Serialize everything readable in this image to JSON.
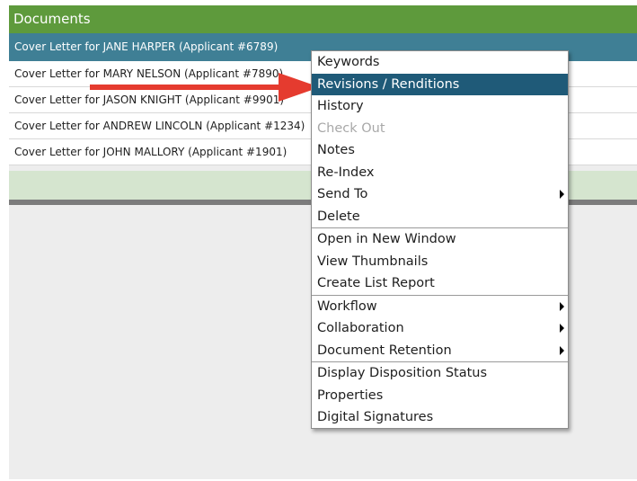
{
  "panel": {
    "title": "Documents",
    "rows": [
      "Cover Letter for JANE HARPER (Applicant #6789)",
      "Cover Letter for MARY NELSON (Applicant #7890)",
      "Cover Letter for JASON KNIGHT (Applicant #9901)",
      "Cover Letter for ANDREW LINCOLN (Applicant #1234)",
      "Cover Letter for JOHN MALLORY (Applicant #1901)"
    ]
  },
  "menu": {
    "groups": [
      [
        "Keywords",
        "Revisions / Renditions",
        "History",
        "Check Out",
        "Notes",
        "Re-Index",
        "Send To",
        "Delete"
      ],
      [
        "Open in New Window",
        "View Thumbnails",
        "Create List Report"
      ],
      [
        "Workflow",
        "Collaboration",
        "Document Retention"
      ],
      [
        "Display Disposition Status",
        "Properties",
        "Digital Signatures"
      ]
    ],
    "active_item": "Revisions / Renditions",
    "disabled_item": "Check Out"
  },
  "colors": {
    "header": "#5e9a3c",
    "selected_row": "#3f7f95",
    "menu_highlight": "#1f5a78",
    "arrow": "#e53b2f"
  },
  "icons": {
    "pointer": "red-arrow-icon",
    "submenu": "submenu-arrow-icon"
  }
}
